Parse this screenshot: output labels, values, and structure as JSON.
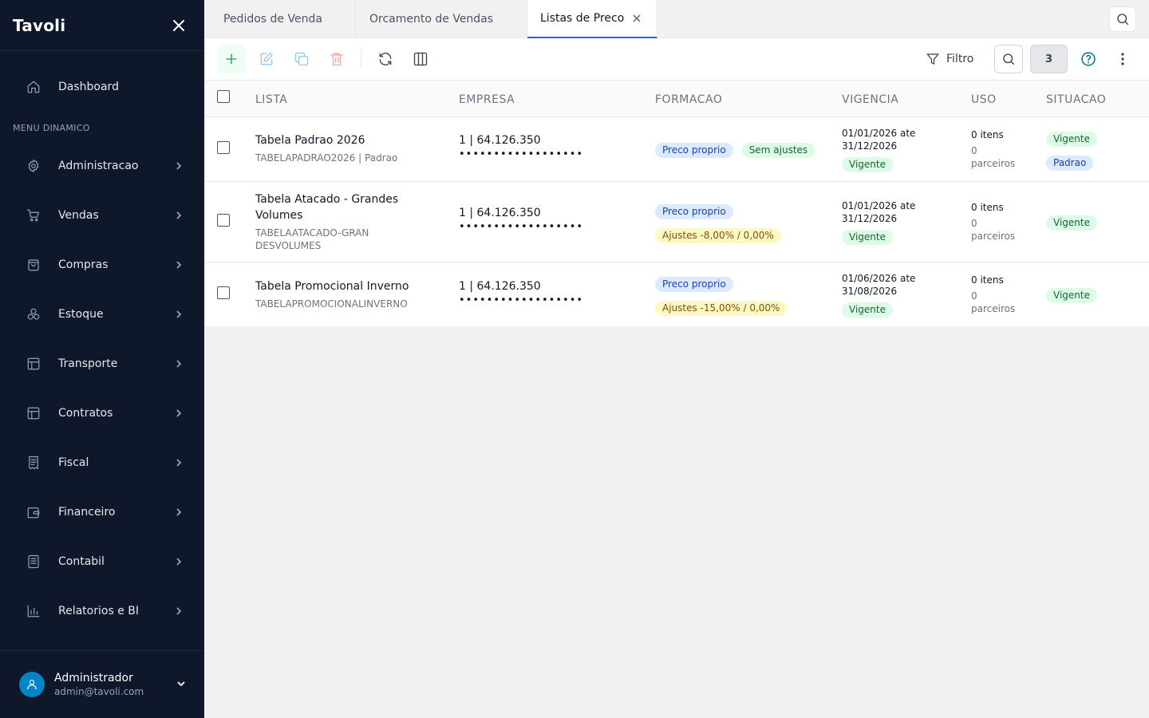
{
  "sidebar": {
    "brand": "Tavoli",
    "dashboard": "Dashboard",
    "section": "MENU DINAMICO",
    "items": [
      {
        "label": "Administracao",
        "icon": "gear-icon"
      },
      {
        "label": "Vendas",
        "icon": "cart-icon"
      },
      {
        "label": "Compras",
        "icon": "shopping-bag-icon"
      },
      {
        "label": "Estoque",
        "icon": "boxes-icon"
      },
      {
        "label": "Transporte",
        "icon": "layout-icon"
      },
      {
        "label": "Contratos",
        "icon": "layout-icon"
      },
      {
        "label": "Fiscal",
        "icon": "receipt-icon"
      },
      {
        "label": "Financeiro",
        "icon": "wallet-icon"
      },
      {
        "label": "Contabil",
        "icon": "ledger-icon"
      },
      {
        "label": "Relatorios e BI",
        "icon": "bar-chart-icon"
      }
    ],
    "user": {
      "name": "Administrador",
      "email": "admin@tavoli.com"
    }
  },
  "tabs": [
    {
      "label": "Pedidos de Venda"
    },
    {
      "label": "Orcamento de Vendas"
    },
    {
      "label": "Listas de Preco"
    }
  ],
  "toolbar": {
    "filter_label": "Filtro",
    "count": "3"
  },
  "table": {
    "columns": [
      "LISTA",
      "EMPRESA",
      "FORMACAO",
      "VIGENCIA",
      "USO",
      "SITUACAO"
    ],
    "rows": [
      {
        "name": "Tabela Padrao 2026",
        "code": "TABELAPADRAO2026 | Padrao",
        "empresa": "1 | 64.126.350",
        "empresa_masked": "••••••••••••••••••",
        "formacao": [
          "Preco proprio",
          "Sem ajustes"
        ],
        "vig_date": "01/01/2026 ate 31/12/2026",
        "vig_status": "Vigente",
        "uso_itens": "0 itens",
        "uso_parceiros": "0 parceiros",
        "situacao": [
          "Vigente",
          "Padrao"
        ]
      },
      {
        "name": "Tabela Atacado - Grandes Volumes",
        "code": "TABELAATACADO-GRANDESVOLUMES",
        "empresa": "1 | 64.126.350",
        "empresa_masked": "••••••••••••••••••",
        "formacao": [
          "Preco proprio",
          "Ajustes -8,00% / 0,00%"
        ],
        "vig_date": "01/01/2026 ate 31/12/2026",
        "vig_status": "Vigente",
        "uso_itens": "0 itens",
        "uso_parceiros": "0 parceiros",
        "situacao": [
          "Vigente"
        ]
      },
      {
        "name": "Tabela Promocional Inverno",
        "code": "TABELAPROMOCIONALINVERNO",
        "empresa": "1 | 64.126.350",
        "empresa_masked": "••••••••••••••••••",
        "formacao": [
          "Preco proprio",
          "Ajustes -15,00% / 0,00%"
        ],
        "vig_date": "01/06/2026 ate 31/08/2026",
        "vig_status": "Vigente",
        "uso_itens": "0 itens",
        "uso_parceiros": "0 parceiros",
        "situacao": [
          "Vigente"
        ]
      }
    ]
  }
}
